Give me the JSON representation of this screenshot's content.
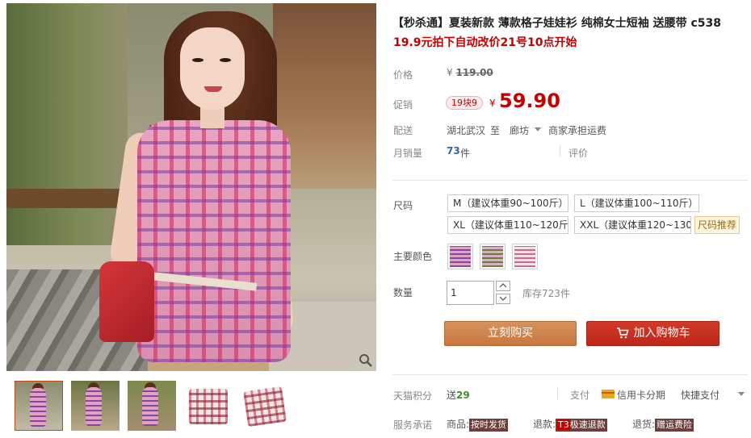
{
  "product": {
    "title": "【秒杀通】夏装新款 薄款格子娃娃衫 纯棉女士短袖 送腰带 c538",
    "subtitle": "19.9元拍下自动改价21号10点开始"
  },
  "price": {
    "label": "价格",
    "currency": "¥",
    "original": "119.00"
  },
  "promo": {
    "label": "促销",
    "badge": "19块9",
    "currency": "¥",
    "price": "59.90"
  },
  "shipping": {
    "label": "配送",
    "from": "湖北武汉",
    "to_word": "至",
    "to": "廊坊",
    "fee": "商家承担运费"
  },
  "sales": {
    "label": "月销量",
    "count": "73",
    "unit": "件",
    "review": "评价"
  },
  "sizes": {
    "label": "尺码",
    "options": [
      "M（建议体重90~100斤）",
      "L（建议体重100~110斤）",
      "XL（建议体重110~120斤",
      "XXL（建议体重120~130"
    ],
    "recommend": "尺码推荐"
  },
  "colors": {
    "label": "主要颜色",
    "swatches": [
      "color-swatch-1",
      "color-swatch-2",
      "color-swatch-3"
    ]
  },
  "quantity": {
    "label": "数量",
    "value": "1",
    "stock": "库存723件"
  },
  "actions": {
    "buy": "立刻购买",
    "cart": "加入购物车"
  },
  "points": {
    "label": "天猫积分",
    "send": "送",
    "amount": "29"
  },
  "payment": {
    "label": "支付",
    "credit": "信用卡分期",
    "quick": "快捷支付"
  },
  "service": {
    "label": "服务承诺",
    "goods_prefix": "商品:",
    "goods_tag": "按时发货",
    "refund_prefix": "退款:",
    "refund_mark": "T3",
    "refund_tag": "极速退款",
    "return_prefix": "退货:",
    "return_tag": "赠运费险"
  },
  "colors_theme": {
    "accent_red": "#c40000",
    "buy_button": "#c8773f",
    "cart_button": "#bd2718"
  }
}
